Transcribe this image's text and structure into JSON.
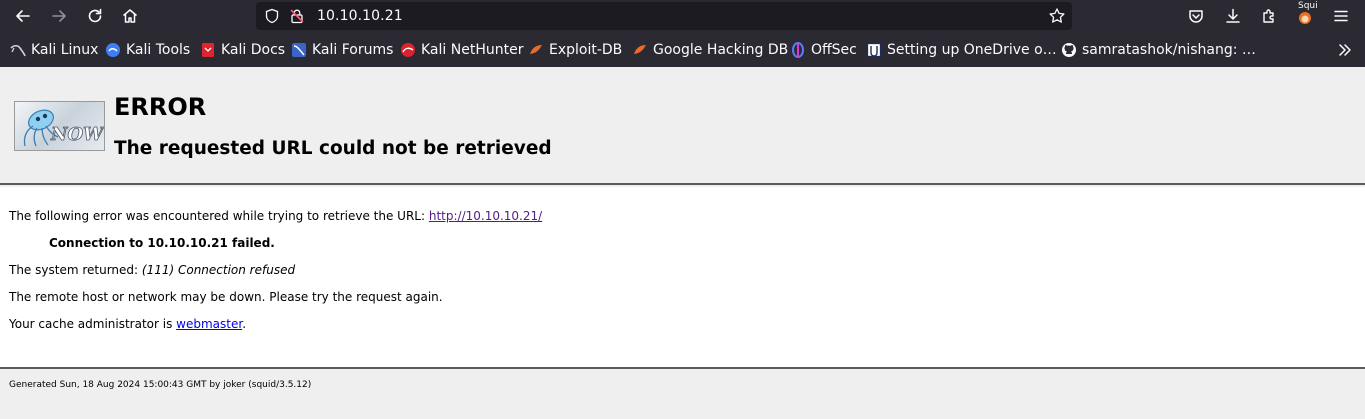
{
  "browser": {
    "url": "10.10.10.21",
    "profile_label": "Squi"
  },
  "bookmarks": [
    {
      "label": "Kali Linux",
      "icon": "kali-dragon-icon"
    },
    {
      "label": "Kali Tools",
      "icon": "kali-tools-icon"
    },
    {
      "label": "Kali Docs",
      "icon": "kali-docs-icon"
    },
    {
      "label": "Kali Forums",
      "icon": "kali-forums-icon"
    },
    {
      "label": "Kali NetHunter",
      "icon": "nethunter-icon"
    },
    {
      "label": "Exploit-DB",
      "icon": "exploit-db-icon"
    },
    {
      "label": "Google Hacking DB",
      "icon": "ghdb-icon"
    },
    {
      "label": "OffSec",
      "icon": "offsec-icon"
    },
    {
      "label": "Setting up OneDrive o…",
      "icon": "onedrive-page-icon"
    },
    {
      "label": "samratashok/nishang: …",
      "icon": "github-icon"
    }
  ],
  "page": {
    "title": "ERROR",
    "subtitle": "The requested URL could not be retrieved",
    "logo_text": "NOW",
    "error_intro": "The following error was encountered while trying to retrieve the URL: ",
    "error_url": "http://10.10.10.21/",
    "error_detail": "Connection to 10.10.10.21 failed.",
    "system_returned_label": "The system returned: ",
    "system_returned_value": "(111) Connection refused",
    "remote_host_msg": "The remote host or network may be down. Please try the request again.",
    "cache_admin_prefix": "Your cache administrator is ",
    "cache_admin_link": "webmaster",
    "cache_admin_suffix": ".",
    "footer": "Generated Sun, 18 Aug 2024 15:00:43 GMT by joker (squid/3.5.12)"
  },
  "colors": {
    "toolbar_bg": "#2b2a33",
    "urlbar_bg": "#1c1b22",
    "page_bg": "#efefef",
    "link": "#0000ee",
    "visited_link": "#551a8b"
  }
}
